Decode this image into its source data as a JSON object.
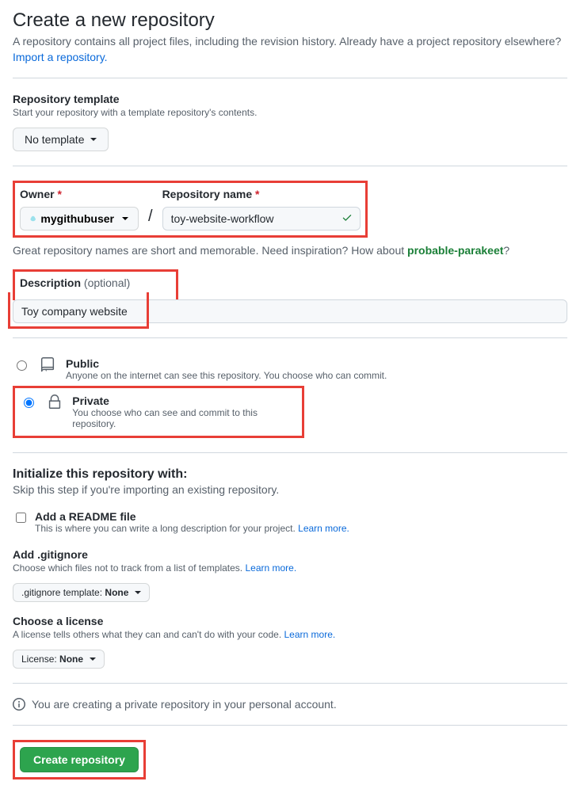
{
  "header": {
    "title": "Create a new repository",
    "subtitle": "A repository contains all project files, including the revision history. Already have a project repository elsewhere?",
    "import_link": "Import a repository."
  },
  "template": {
    "label": "Repository template",
    "hint": "Start your repository with a template repository's contents.",
    "button": "No template"
  },
  "owner": {
    "label": "Owner",
    "value": "mygithubuser"
  },
  "repo_name": {
    "label": "Repository name",
    "value": "toy-website-workflow"
  },
  "name_hint": {
    "prefix": "Great repository names are short and memorable. Need inspiration? How about ",
    "suggestion": "probable-parakeet",
    "suffix": "?"
  },
  "description": {
    "label": "Description",
    "optional": "(optional)",
    "value": "Toy company website"
  },
  "visibility": {
    "public": {
      "title": "Public",
      "desc": "Anyone on the internet can see this repository. You choose who can commit."
    },
    "private": {
      "title": "Private",
      "desc": "You choose who can see and commit to this repository."
    }
  },
  "init": {
    "heading": "Initialize this repository with:",
    "skip_hint": "Skip this step if you're importing an existing repository.",
    "readme": {
      "title": "Add a README file",
      "desc_prefix": "This is where you can write a long description for your project. ",
      "learn": "Learn more."
    },
    "gitignore": {
      "title": "Add .gitignore",
      "desc_prefix": "Choose which files not to track from a list of templates. ",
      "learn": "Learn more.",
      "button_prefix": ".gitignore template: ",
      "button_value": "None"
    },
    "license": {
      "title": "Choose a license",
      "desc_prefix": "A license tells others what they can and can't do with your code. ",
      "learn": "Learn more.",
      "button_prefix": "License: ",
      "button_value": "None"
    }
  },
  "info_banner": "You are creating a private repository in your personal account.",
  "submit": "Create repository"
}
